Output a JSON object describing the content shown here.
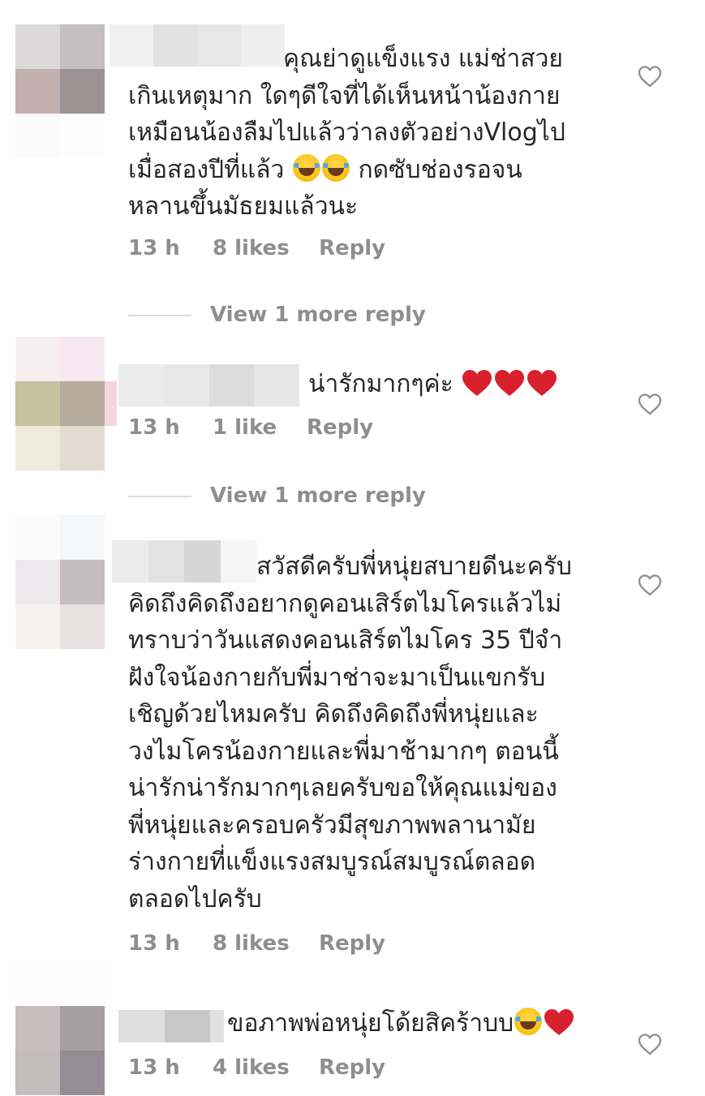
{
  "comments": [
    {
      "text_lines": [
        "คุณย่าดูแข็งแรง แม่ช่าสวย",
        "เกินเหตุมาก ใดๆดีใจที่ได้เห็นหน้าน้องกาย",
        "เหมือนน้องลืมไปแล้วว่าลงตัวอย่างVlogไป",
        "เมื่อสองปีที่แล้ว",
        "กดซับช่องรอจน",
        "หลานขึ้นมัธยมแล้วนะ"
      ],
      "time": "13 h",
      "likes": "8 likes",
      "reply": "Reply",
      "view_replies": "View 1 more reply"
    },
    {
      "text_lines": [
        "น่ารักมากๆค่ะ"
      ],
      "time": "13 h",
      "likes": "1 like",
      "reply": "Reply",
      "view_replies": "View 1 more reply"
    },
    {
      "text_lines": [
        "สวัสดีครับพี่หนุ่ยสบายดีนะครับ",
        "คิดถึงคิดถึงอยากดูคอนเสิร์ตไมโครแล้วไม่",
        "ทราบว่าวันแสดงคอนเสิร์ตไมโคร 35 ปีจำ",
        "ฝังใจน้องกายกับพี่มาช่าจะมาเป็นแขกรับ",
        "เชิญด้วยไหมครับ คิดถึงคิดถึงพี่หนุ่ยและ",
        "วงไมโครน้องกายและพี่มาช้ามากๆ ตอนนี้",
        "น่ารักน่ารักมากๆเลยครับขอให้คุณแม่ของ",
        "พี่หนุ่ยและครอบครัวมีสุขภาพพลานามัย",
        "ร่างกายที่แข็งแรงสมบูรณ์สมบูรณ์ตลอด",
        "ตลอดไปครับ"
      ],
      "time": "13 h",
      "likes": "8 likes",
      "reply": "Reply"
    },
    {
      "text_lines": [
        "ขอภาพพ่อหนุ่ยโด้ยสิคร้าบบ"
      ],
      "time": "13 h",
      "likes": "4 likes",
      "reply": "Reply"
    }
  ],
  "icons": {
    "like": "heart-outline-icon",
    "laugh_emoji": "face-with-tears-of-joy-emoji",
    "heart_emoji": "red-heart-emoji"
  },
  "colors": {
    "text": "#262626",
    "meta": "#8e8e8e",
    "divider": "#dbdbdb",
    "heart_emoji": "#d9202f"
  }
}
